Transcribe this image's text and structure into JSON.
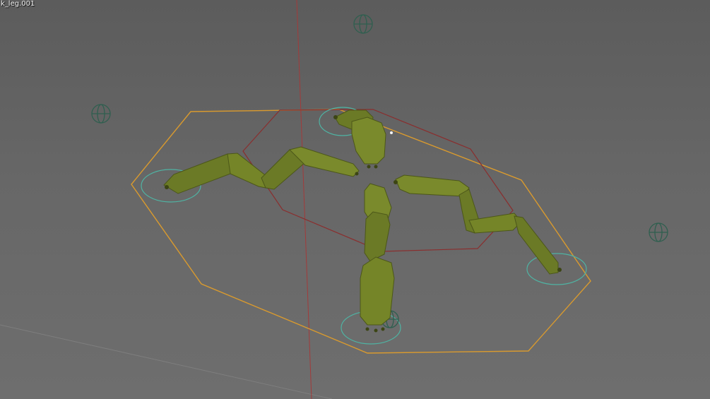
{
  "viewport": {
    "active_object_name": "k_leg.001",
    "background_color": "#636363"
  },
  "colors": {
    "x_axis": "#a33a3a",
    "grid_line": "#7a7a7a",
    "leg_body": "#6b7a26",
    "leg_shadow": "#4c5719",
    "leg_highlight": "#8a9a36",
    "selection_outline_active": "#e0a030",
    "selection_outline": "#8a2e2e",
    "ik_target_circle": "#4fb3a3",
    "empty_sphere": "#2f5f4f"
  },
  "icons": [
    "empty-sphere-icon",
    "ik-target-circle-icon"
  ]
}
